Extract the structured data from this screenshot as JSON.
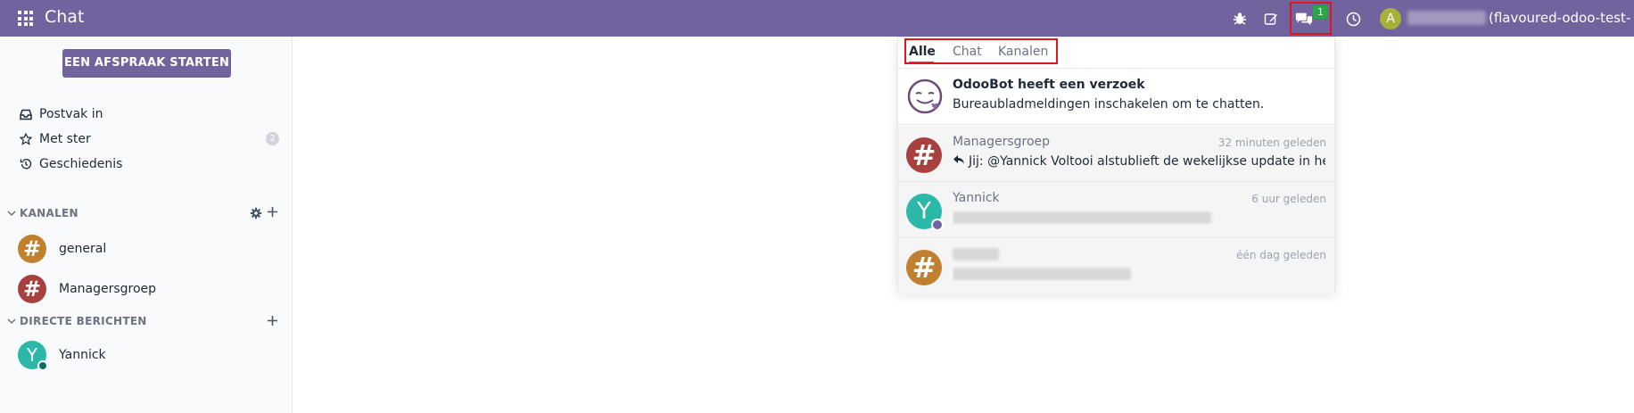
{
  "app": {
    "title": "Chat",
    "db_name": "(flavoured-odoo-test-si...",
    "user_initial": "A",
    "chat_badge": "1"
  },
  "colors": {
    "navbar": "#71639e",
    "badge": "#28a745",
    "highlight": "#e0161f"
  },
  "icons": [
    "apps-grid-icon",
    "bug-icon",
    "edit-icon",
    "chat-bubbles-icon",
    "clock-icon"
  ],
  "sidebar": {
    "meeting_button": "EEN AFSPRAAK STARTEN",
    "mailboxes": [
      {
        "label": "Postvak in",
        "icon": "inbox-icon"
      },
      {
        "label": "Met ster",
        "icon": "star-icon",
        "count": "2"
      },
      {
        "label": "Geschiedenis",
        "icon": "history-icon"
      }
    ],
    "channels_header": "KANALEN",
    "channels": [
      {
        "label": "general",
        "color": "#c0802e"
      },
      {
        "label": "Managersgroep",
        "color": "#a8403f"
      }
    ],
    "dm_header": "DIRECTE BERICHTEN",
    "direct_messages": [
      {
        "label": "Yannick",
        "initial": "Y",
        "color": "#2bb8a8"
      }
    ]
  },
  "dropdown": {
    "tabs": [
      "Alle",
      "Chat",
      "Kanalen"
    ],
    "notifications": [
      {
        "title": "OdooBot heeft een verzoek",
        "preview": "Bureaubladmeldingen inschakelen om te chatten."
      },
      {
        "title": "Managersgroep",
        "time": "32 minuten geleden",
        "preview": "Jij: @Yannick Voltooi alstublieft de wekelijkse update in he…",
        "color": "#a8403f"
      },
      {
        "title": "Yannick",
        "time": "6 uur geleden",
        "initial": "Y",
        "color": "#2bb8a8"
      },
      {
        "time": "één dag geleden",
        "color": "#c0802e"
      }
    ]
  }
}
